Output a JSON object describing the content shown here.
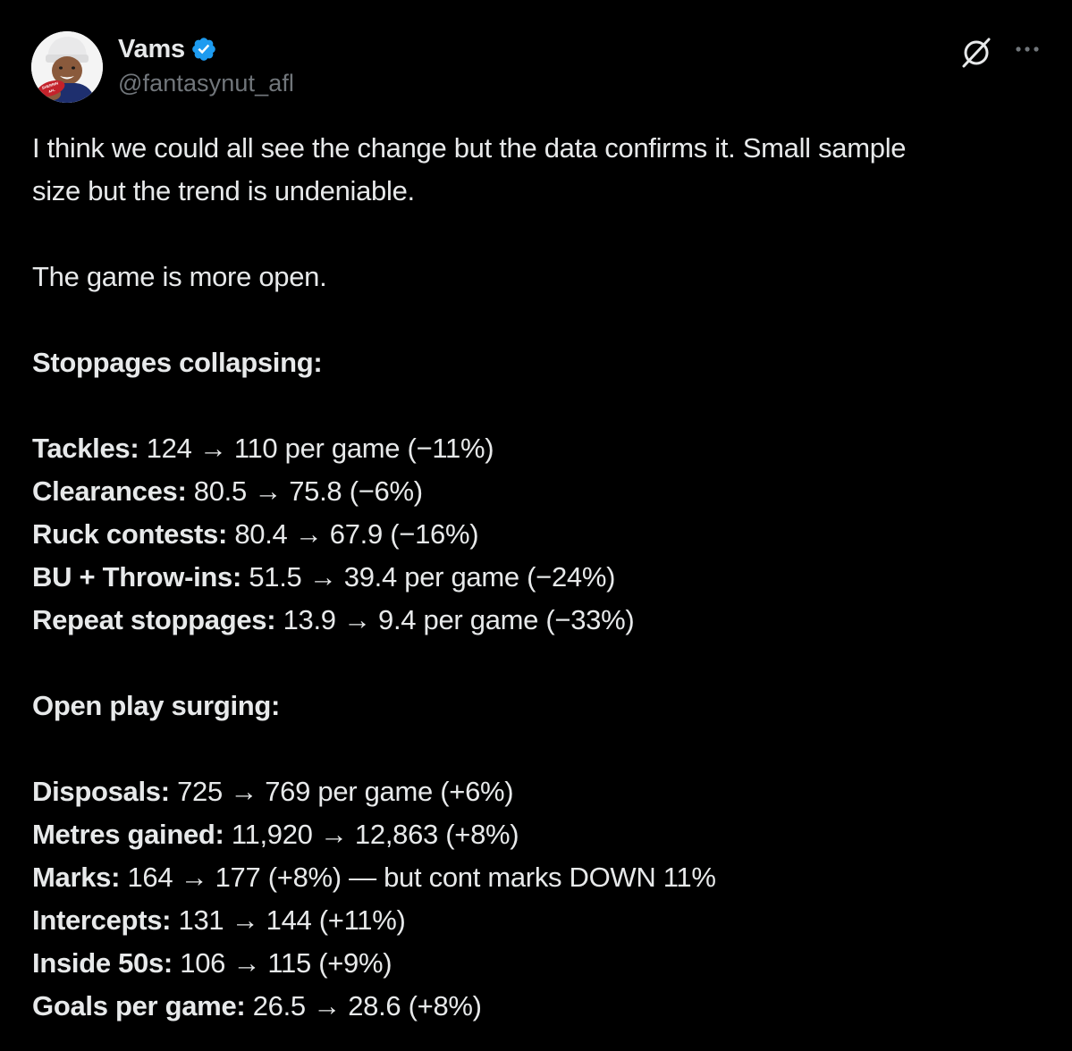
{
  "author": {
    "name": "Vams",
    "handle": "@fantasynut_afl",
    "verified": true,
    "verified_color": "#1d9bf0"
  },
  "avatar": {
    "football_text_1": "SHERRIN",
    "football_text_2": "AFL"
  },
  "actions": {
    "grok_icon": "grok-icon",
    "more_icon": "more-icon"
  },
  "content": {
    "intro_line_1": "I think we could all see the change but the data confirms it. Small sample",
    "intro_line_2": "size but the trend is undeniable.",
    "statement": "The game is more open.",
    "section_1_heading": "Stoppages collapsing:",
    "section_1_stats": [
      {
        "label": "Tackles:",
        "value": " 124 → 110 per game (−11%)"
      },
      {
        "label": "Clearances:",
        "value": " 80.5 → 75.8 (−6%)"
      },
      {
        "label": "Ruck contests:",
        "value": " 80.4 → 67.9 (−16%)"
      },
      {
        "label": "BU + Throw-ins:",
        "value": " 51.5 → 39.4 per game (−24%)"
      },
      {
        "label": "Repeat stoppages:",
        "value": " 13.9 → 9.4 per game (−33%)"
      }
    ],
    "section_2_heading": "Open play surging:",
    "section_2_stats": [
      {
        "label": "Disposals:",
        "value": " 725 → 769 per game (+6%)"
      },
      {
        "label": "Metres gained:",
        "value": " 11,920 → 12,863 (+8%)"
      },
      {
        "label": "Marks:",
        "value": " 164 → 177 (+8%) — but cont marks DOWN 11%"
      },
      {
        "label": "Intercepts:",
        "value": " 131 → 144 (+11%)"
      },
      {
        "label": "Inside 50s:",
        "value": " 106 → 115 (+9%)"
      },
      {
        "label": "Goals per game:",
        "value": " 26.5 → 28.6 (+8%)"
      }
    ]
  },
  "colors": {
    "background": "#000000",
    "text": "#e7e9ea",
    "secondary_text": "#71767b"
  }
}
